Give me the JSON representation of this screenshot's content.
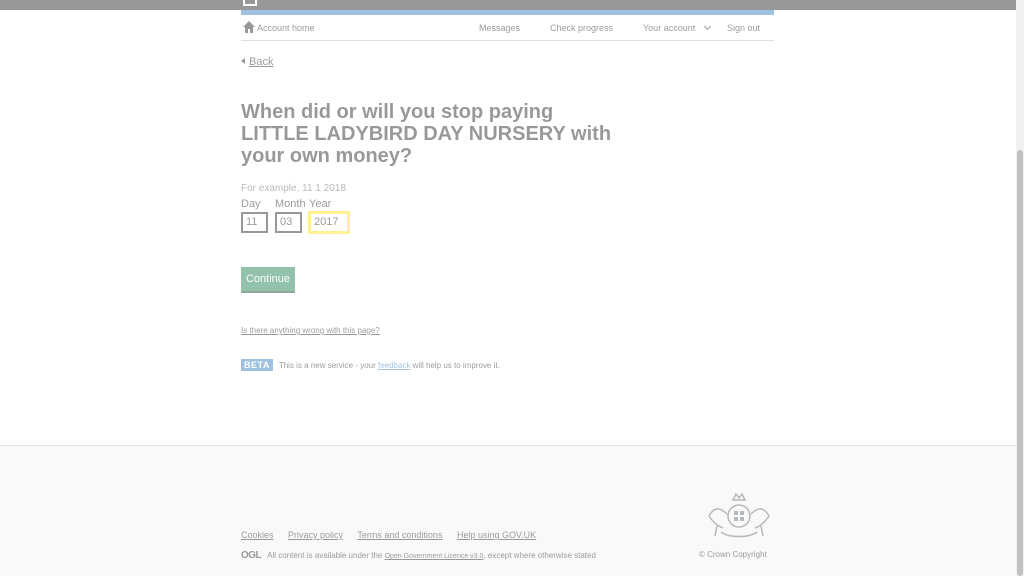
{
  "header": {
    "logo_text": "L"
  },
  "nav": {
    "home": "Account home",
    "messages": "Messages",
    "check_progress": "Check progress",
    "your_account": "Your account",
    "sign_out": "Sign out"
  },
  "back_label": "Back",
  "question": {
    "heading": "When did or will you stop paying LITTLE LADYBIRD DAY NURSERY with your own money?",
    "hint": "For example, 11 1 2018"
  },
  "date": {
    "day_label": "Day",
    "day_value": "11",
    "month_label": "Month",
    "month_value": "03",
    "year_label": "Year",
    "year_value": "2017"
  },
  "continue_label": "Continue",
  "report_link": "Is there anything wrong with this page?",
  "beta": {
    "tag": "BETA",
    "text_before": "This is a new service  - your ",
    "feedback": "feedback",
    "text_after": " will help us to improve it."
  },
  "footer": {
    "links": [
      "Cookies",
      "Privacy policy",
      "Terms and conditions",
      "Help using GOV.UK"
    ],
    "ogl": "OGL",
    "licence_before": "All content is available under the ",
    "licence_link": "Open Government Licence v3.0",
    "licence_after": ", except where otherwise stated",
    "copyright": "© Crown Copyright"
  },
  "colors": {
    "brand_blue": "#1d70b8",
    "button_green": "#00703c",
    "focus_yellow": "#ffdd00"
  }
}
